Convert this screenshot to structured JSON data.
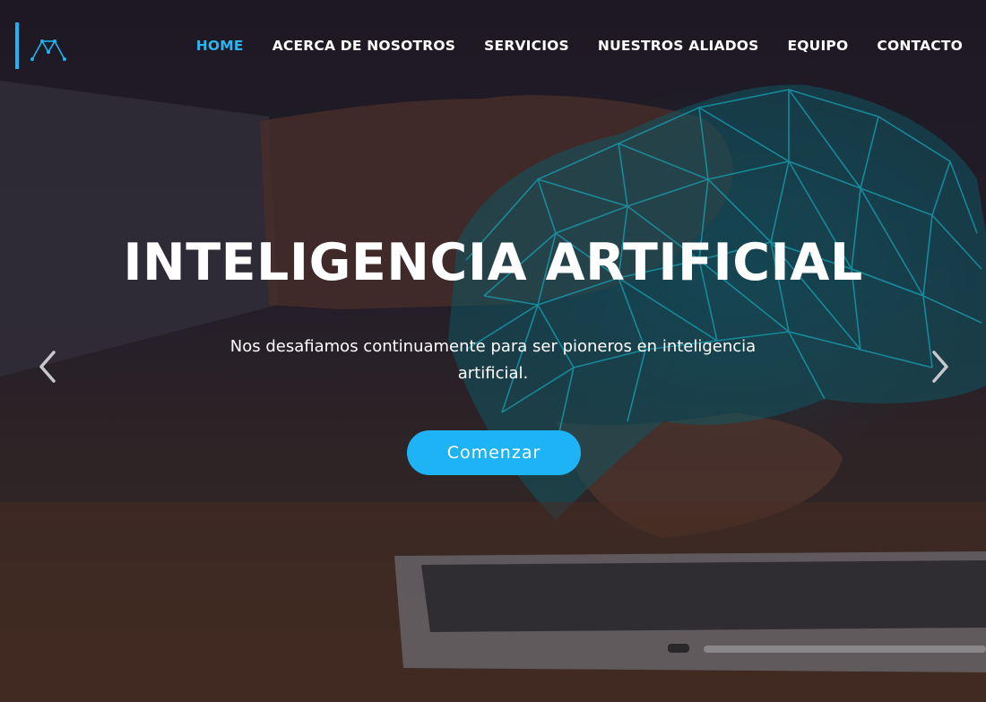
{
  "brand": {
    "accent_color": "#1eb3f5",
    "logo_icon": "mountain-network-logo-icon"
  },
  "nav": {
    "items": [
      {
        "label": "HOME",
        "active": true
      },
      {
        "label": "ACERCA DE NOSOTROS",
        "active": false
      },
      {
        "label": "SERVICIOS",
        "active": false
      },
      {
        "label": "NUESTROS ALIADOS",
        "active": false
      },
      {
        "label": "EQUIPO",
        "active": false
      },
      {
        "label": "CONTACTO",
        "active": false
      }
    ]
  },
  "hero": {
    "title": "INTELIGENCIA ARTIFICIAL",
    "subtitle": "Nos desafiamos continuamente para ser pioneros en inteligencia artificial.",
    "cta_label": "Comenzar",
    "prev_icon": "chevron-left-icon",
    "next_icon": "chevron-right-icon"
  }
}
